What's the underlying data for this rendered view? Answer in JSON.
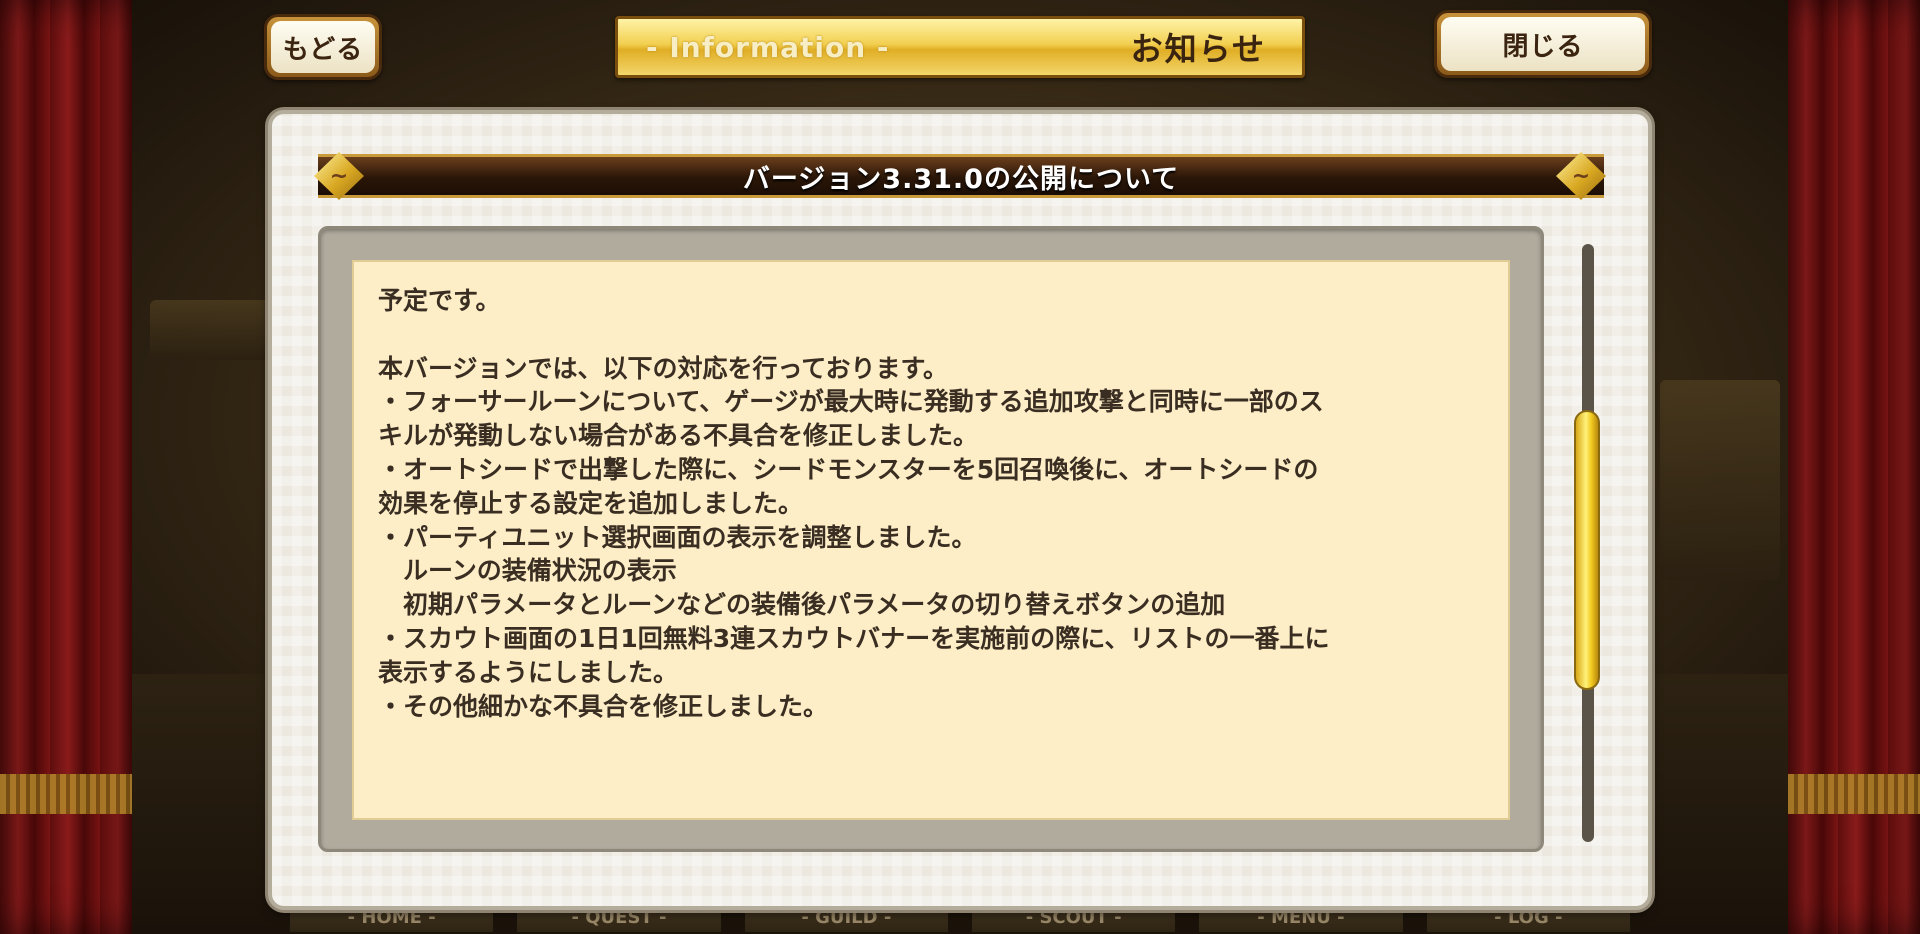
{
  "top_bar": {
    "back_label": "もどる",
    "close_label": "閉じる",
    "header_subtitle": "- Information -",
    "header_title": "お知らせ"
  },
  "notice": {
    "title": "バージョン3.31.0の公開について",
    "body": "予定です。\n\n本バージョンでは、以下の対応を行っております。\n・フォーサールーンについて、ゲージが最大時に発動する追加攻撃と同時に一部のス\nキルが発動しない場合がある不具合を修正しました。\n・オートシードで出撃した際に、シードモンスターを5回召喚後に、オートシードの\n効果を停止する設定を追加しました。\n・パーティユニット選択画面の表示を調整しました。\n　ルーンの装備状況の表示\n　初期パラメータとルーンなどの装備後パラメータの切り替えボタンの追加\n・スカウト画面の1日1回無料3連スカウトバナーを実施前の際に、リストの一番上に\n表示するようにしました。\n・その他細かな不具合を修正しました。"
  },
  "bottom_nav": {
    "tabs": [
      "- HOME -",
      "- QUEST -",
      "- GUILD -",
      "- SCOUT -",
      "- MENU -",
      "- LOG -"
    ]
  },
  "colors": {
    "paper": "#fdeec8",
    "scroll_thumb": "#f2c91f",
    "banner_gold": "#f2cf4f"
  }
}
